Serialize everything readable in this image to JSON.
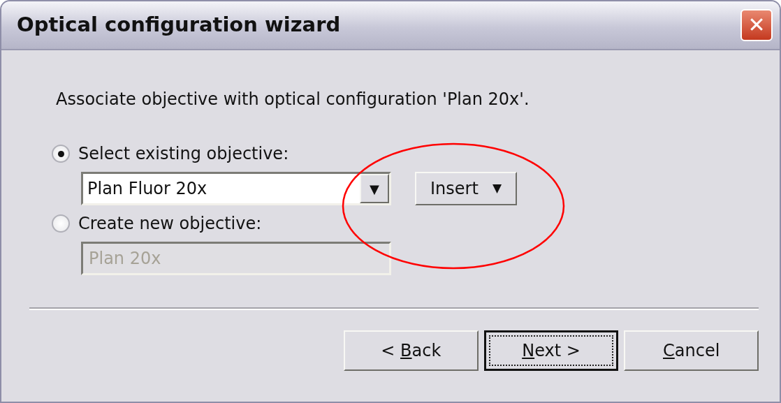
{
  "window": {
    "title": "Optical configuration wizard",
    "close_glyph": "✕"
  },
  "instruction": "Associate objective with optical configuration 'Plan 20x'.",
  "options": [
    {
      "kind": "combo",
      "label": "Select existing objective:",
      "selected": true,
      "value": "Plan Fluor 20x",
      "dropdown_glyph": "▼"
    },
    {
      "kind": "text",
      "label": "Create new objective:",
      "selected": false,
      "placeholder": "Plan 20x",
      "disabled": true
    }
  ],
  "insert_button": {
    "label": "Insert",
    "caret": "▼"
  },
  "buttons": [
    {
      "before": "< ",
      "access_key": "B",
      "after": "ack",
      "default": false
    },
    {
      "access_key": "N",
      "after": "ext >",
      "default": true
    },
    {
      "access_key": "C",
      "after": "ancel",
      "default": false
    }
  ],
  "annotation": {
    "kind": "ellipse",
    "color": "#ff0000"
  }
}
